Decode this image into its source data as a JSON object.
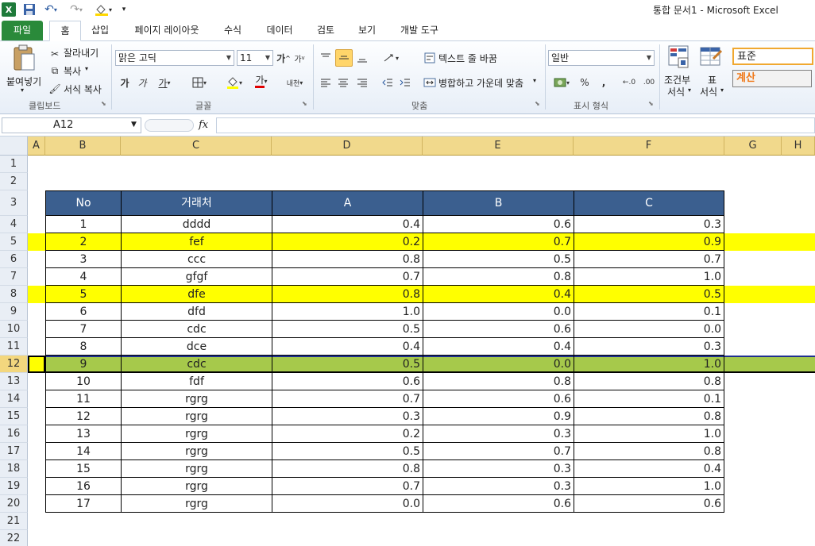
{
  "app": {
    "title": "통합 문서1  -  Microsoft Excel",
    "excel_icon": "X",
    "save_icon": "save-icon",
    "undo_icon": "undo-icon",
    "redo_icon": "redo-icon",
    "fill_icon": "paint-bucket-icon"
  },
  "tabs": [
    {
      "label": "파일"
    },
    {
      "label": "홈"
    },
    {
      "label": "삽입"
    },
    {
      "label": "페이지 레이아웃"
    },
    {
      "label": "수식"
    },
    {
      "label": "데이터"
    },
    {
      "label": "검토"
    },
    {
      "label": "보기"
    },
    {
      "label": "개발 도구"
    }
  ],
  "ribbon": {
    "clipboard": {
      "paste": "붙여넣기",
      "cut": "잘라내기",
      "copy": "복사",
      "format_painter": "서식 복사",
      "group": "클립보드"
    },
    "font": {
      "name": "맑은 고딕",
      "size": "11",
      "grow": "가",
      "shrink": "가",
      "bold": "가",
      "italic": "가",
      "underline": "가",
      "font_color": "가",
      "phonetic": "내천",
      "group": "글꼴"
    },
    "alignment": {
      "wrap": "텍스트 줄 바꿈",
      "merge": "병합하고 가운데 맞춤",
      "group": "맞춤"
    },
    "number": {
      "format": "일반",
      "percent": "%",
      "comma": ",",
      "inc_decimal": "←.0",
      "dec_decimal": ".00",
      "group": "표시 형식"
    },
    "styles": {
      "conditional": "조건부",
      "conditional2": "서식",
      "table": "표",
      "table2": "서식",
      "normal": "표준",
      "calc": "계산"
    }
  },
  "formula_bar": {
    "name_box": "A12",
    "fx": "fx",
    "formula": ""
  },
  "sheet": {
    "columns": [
      "A",
      "B",
      "C",
      "D",
      "E",
      "F",
      "G",
      "H"
    ],
    "rows": [
      "1",
      "2",
      "3",
      "4",
      "5",
      "6",
      "7",
      "8",
      "9",
      "10",
      "11",
      "12",
      "13",
      "14",
      "15",
      "16",
      "17",
      "18",
      "19",
      "20",
      "21",
      "22"
    ],
    "headers": [
      "No",
      "거래처",
      "A",
      "B",
      "C"
    ],
    "data": [
      [
        "1",
        "dddd",
        "0.4",
        "0.6",
        "0.3"
      ],
      [
        "2",
        "fef",
        "0.2",
        "0.7",
        "0.9"
      ],
      [
        "3",
        "ccc",
        "0.8",
        "0.5",
        "0.7"
      ],
      [
        "4",
        "gfgf",
        "0.7",
        "0.8",
        "1.0"
      ],
      [
        "5",
        "dfe",
        "0.8",
        "0.4",
        "0.5"
      ],
      [
        "6",
        "dfd",
        "1.0",
        "0.0",
        "0.1"
      ],
      [
        "7",
        "cdc",
        "0.5",
        "0.6",
        "0.0"
      ],
      [
        "8",
        "dce",
        "0.4",
        "0.4",
        "0.3"
      ],
      [
        "9",
        "cdc",
        "0.5",
        "0.0",
        "1.0"
      ],
      [
        "10",
        "fdf",
        "0.6",
        "0.8",
        "0.8"
      ],
      [
        "11",
        "rgrg",
        "0.7",
        "0.6",
        "0.1"
      ],
      [
        "12",
        "rgrg",
        "0.3",
        "0.9",
        "0.8"
      ],
      [
        "13",
        "rgrg",
        "0.2",
        "0.3",
        "1.0"
      ],
      [
        "14",
        "rgrg",
        "0.5",
        "0.7",
        "0.8"
      ],
      [
        "15",
        "rgrg",
        "0.8",
        "0.3",
        "0.4"
      ],
      [
        "16",
        "rgrg",
        "0.7",
        "0.3",
        "1.0"
      ],
      [
        "17",
        "rgrg",
        "0.0",
        "0.6",
        "0.6"
      ]
    ],
    "highlight_rows": {
      "5": "#ffff00",
      "8": "#ffff00",
      "12": "#a6c94b"
    },
    "header_fill": "#3b5f8f",
    "selected_row": "12"
  }
}
